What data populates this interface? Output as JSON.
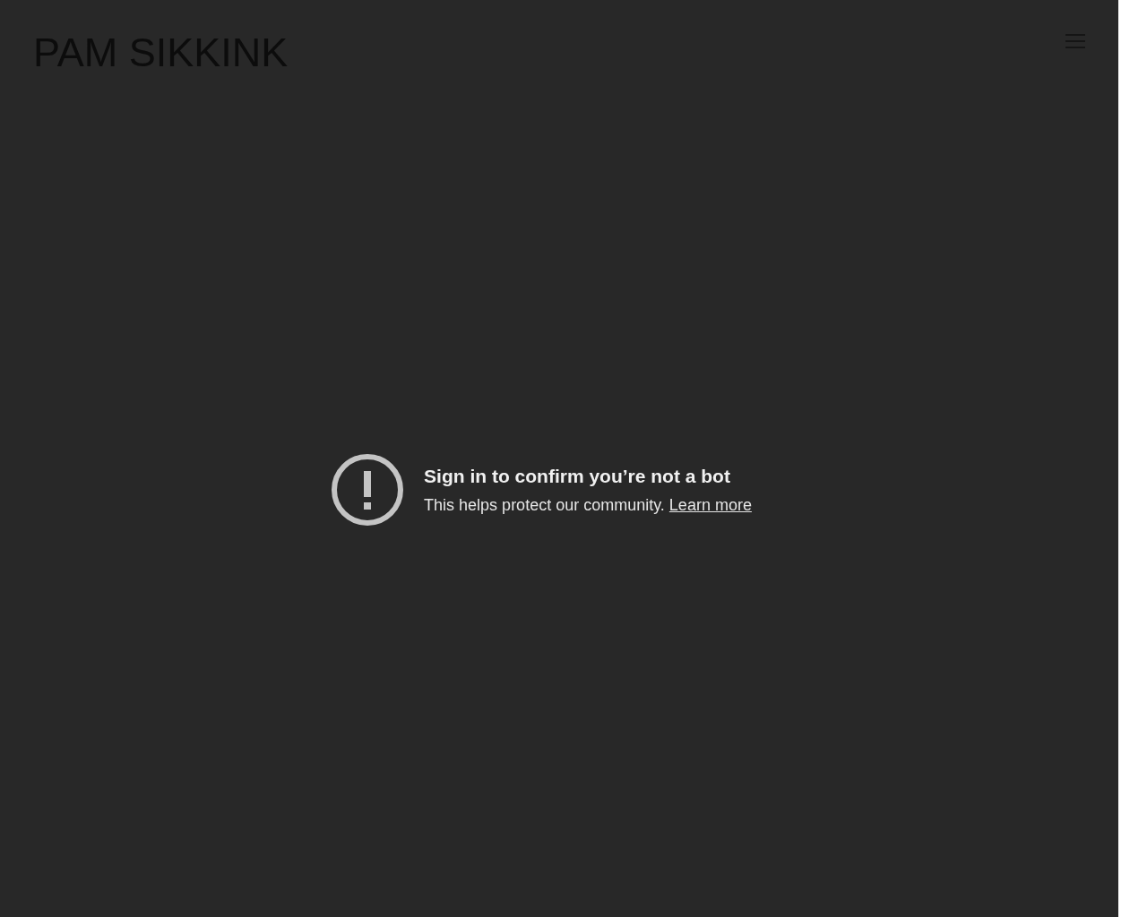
{
  "site_title": "PAM SIKKINK",
  "message": {
    "title": "Sign in to confirm you’re not a bot",
    "text": "This helps protect our community.",
    "link": "Learn more"
  }
}
